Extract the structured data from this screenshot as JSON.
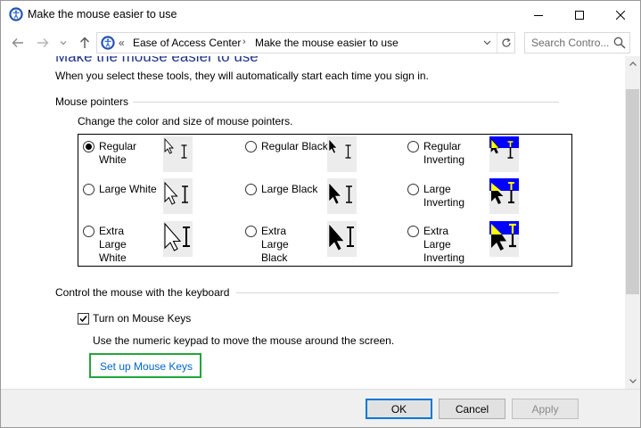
{
  "window": {
    "title": "Make the mouse easier to use",
    "controls": {
      "minimize": "minimize",
      "maximize": "maximize",
      "close": "close"
    }
  },
  "nav": {
    "breadcrumb_chevron": "«",
    "crumbs": [
      "Ease of Access Center",
      "Make the mouse easier to use"
    ],
    "separator": "›",
    "search_placeholder": "Search Contro..."
  },
  "content": {
    "page_title": "Make the mouse easier to use",
    "intro": "When you select these tools, they will automatically start each time you sign in.",
    "pointers_section": {
      "heading": "Mouse pointers",
      "subtext": "Change the color and size of mouse pointers.",
      "options": [
        {
          "label": "Regular White",
          "checked": true
        },
        {
          "label": "Regular Black",
          "checked": false
        },
        {
          "label": "Regular Inverting",
          "checked": false
        },
        {
          "label": "Large White",
          "checked": false
        },
        {
          "label": "Large Black",
          "checked": false
        },
        {
          "label": "Large Inverting",
          "checked": false
        },
        {
          "label": "Extra Large White",
          "checked": false
        },
        {
          "label": "Extra Large Black",
          "checked": false
        },
        {
          "label": "Extra Large Inverting",
          "checked": false
        }
      ]
    },
    "keyboard_section": {
      "heading": "Control the mouse with the keyboard",
      "mouse_keys_label": "Turn on Mouse Keys",
      "mouse_keys_checked": true,
      "mouse_keys_desc": "Use the numeric keypad to move the mouse around the screen.",
      "setup_link": "Set up Mouse Keys"
    }
  },
  "footer": {
    "ok": "OK",
    "cancel": "Cancel",
    "apply": "Apply"
  },
  "colors": {
    "title_blue": "#1e3287",
    "link_blue": "#0066cc",
    "highlight_green": "#21a53a",
    "inverting_blue": "#0000ff",
    "inverting_yellow": "#ffff00"
  }
}
